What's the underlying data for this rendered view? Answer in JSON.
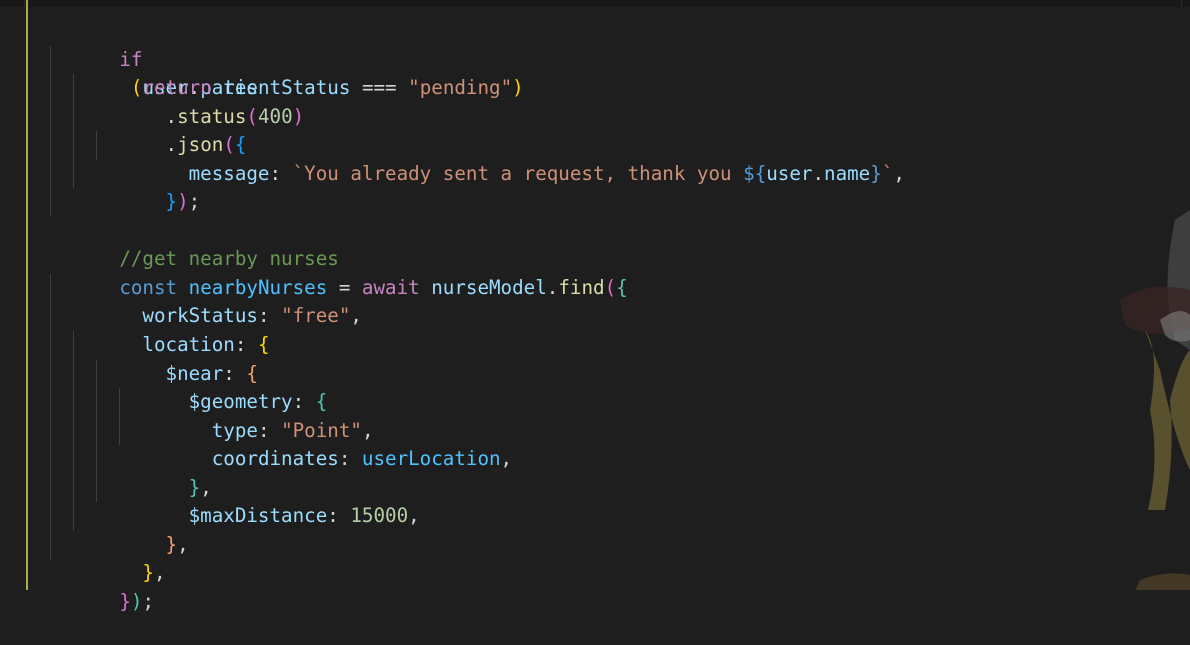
{
  "editor": {
    "colors": {
      "background": "#1e1e1e",
      "keyword": "#c586c0",
      "variable": "#9cdcfe",
      "string": "#ce9178",
      "comment": "#6a9955",
      "number": "#b5cea8",
      "function": "#dcdcaa"
    },
    "lines": [
      "if (user.patientStatus === \"pending\")",
      "  return res",
      "    .status(400)",
      "    .json({",
      "      message: `You already sent a request, thank you ${user.name}`,",
      "    });",
      "",
      "//get nearby nurses",
      "const nearbyNurses = await nurseModel.find({",
      "  workStatus: \"free\",",
      "  location: {",
      "    $near: {",
      "      $geometry: {",
      "        type: \"Point\",",
      "        coordinates: userLocation,",
      "      },",
      "      $maxDistance: 15000,",
      "    },",
      "  },",
      "});"
    ]
  }
}
